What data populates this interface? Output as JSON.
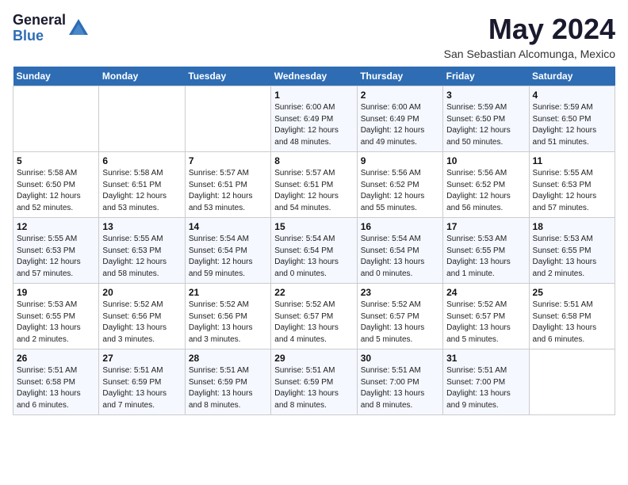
{
  "header": {
    "logo_general": "General",
    "logo_blue": "Blue",
    "month_title": "May 2024",
    "location": "San Sebastian Alcomunga, Mexico"
  },
  "weekdays": [
    "Sunday",
    "Monday",
    "Tuesday",
    "Wednesday",
    "Thursday",
    "Friday",
    "Saturday"
  ],
  "weeks": [
    [
      null,
      null,
      null,
      {
        "day": "1",
        "sunrise": "6:00 AM",
        "sunset": "6:49 PM",
        "daylight": "12 hours and 48 minutes."
      },
      {
        "day": "2",
        "sunrise": "6:00 AM",
        "sunset": "6:49 PM",
        "daylight": "12 hours and 49 minutes."
      },
      {
        "day": "3",
        "sunrise": "5:59 AM",
        "sunset": "6:50 PM",
        "daylight": "12 hours and 50 minutes."
      },
      {
        "day": "4",
        "sunrise": "5:59 AM",
        "sunset": "6:50 PM",
        "daylight": "12 hours and 51 minutes."
      }
    ],
    [
      {
        "day": "5",
        "sunrise": "5:58 AM",
        "sunset": "6:50 PM",
        "daylight": "12 hours and 52 minutes."
      },
      {
        "day": "6",
        "sunrise": "5:58 AM",
        "sunset": "6:51 PM",
        "daylight": "12 hours and 53 minutes."
      },
      {
        "day": "7",
        "sunrise": "5:57 AM",
        "sunset": "6:51 PM",
        "daylight": "12 hours and 53 minutes."
      },
      {
        "day": "8",
        "sunrise": "5:57 AM",
        "sunset": "6:51 PM",
        "daylight": "12 hours and 54 minutes."
      },
      {
        "day": "9",
        "sunrise": "5:56 AM",
        "sunset": "6:52 PM",
        "daylight": "12 hours and 55 minutes."
      },
      {
        "day": "10",
        "sunrise": "5:56 AM",
        "sunset": "6:52 PM",
        "daylight": "12 hours and 56 minutes."
      },
      {
        "day": "11",
        "sunrise": "5:55 AM",
        "sunset": "6:53 PM",
        "daylight": "12 hours and 57 minutes."
      }
    ],
    [
      {
        "day": "12",
        "sunrise": "5:55 AM",
        "sunset": "6:53 PM",
        "daylight": "12 hours and 57 minutes."
      },
      {
        "day": "13",
        "sunrise": "5:55 AM",
        "sunset": "6:53 PM",
        "daylight": "12 hours and 58 minutes."
      },
      {
        "day": "14",
        "sunrise": "5:54 AM",
        "sunset": "6:54 PM",
        "daylight": "12 hours and 59 minutes."
      },
      {
        "day": "15",
        "sunrise": "5:54 AM",
        "sunset": "6:54 PM",
        "daylight": "13 hours and 0 minutes."
      },
      {
        "day": "16",
        "sunrise": "5:54 AM",
        "sunset": "6:54 PM",
        "daylight": "13 hours and 0 minutes."
      },
      {
        "day": "17",
        "sunrise": "5:53 AM",
        "sunset": "6:55 PM",
        "daylight": "13 hours and 1 minute."
      },
      {
        "day": "18",
        "sunrise": "5:53 AM",
        "sunset": "6:55 PM",
        "daylight": "13 hours and 2 minutes."
      }
    ],
    [
      {
        "day": "19",
        "sunrise": "5:53 AM",
        "sunset": "6:55 PM",
        "daylight": "13 hours and 2 minutes."
      },
      {
        "day": "20",
        "sunrise": "5:52 AM",
        "sunset": "6:56 PM",
        "daylight": "13 hours and 3 minutes."
      },
      {
        "day": "21",
        "sunrise": "5:52 AM",
        "sunset": "6:56 PM",
        "daylight": "13 hours and 3 minutes."
      },
      {
        "day": "22",
        "sunrise": "5:52 AM",
        "sunset": "6:57 PM",
        "daylight": "13 hours and 4 minutes."
      },
      {
        "day": "23",
        "sunrise": "5:52 AM",
        "sunset": "6:57 PM",
        "daylight": "13 hours and 5 minutes."
      },
      {
        "day": "24",
        "sunrise": "5:52 AM",
        "sunset": "6:57 PM",
        "daylight": "13 hours and 5 minutes."
      },
      {
        "day": "25",
        "sunrise": "5:51 AM",
        "sunset": "6:58 PM",
        "daylight": "13 hours and 6 minutes."
      }
    ],
    [
      {
        "day": "26",
        "sunrise": "5:51 AM",
        "sunset": "6:58 PM",
        "daylight": "13 hours and 6 minutes."
      },
      {
        "day": "27",
        "sunrise": "5:51 AM",
        "sunset": "6:59 PM",
        "daylight": "13 hours and 7 minutes."
      },
      {
        "day": "28",
        "sunrise": "5:51 AM",
        "sunset": "6:59 PM",
        "daylight": "13 hours and 8 minutes."
      },
      {
        "day": "29",
        "sunrise": "5:51 AM",
        "sunset": "6:59 PM",
        "daylight": "13 hours and 8 minutes."
      },
      {
        "day": "30",
        "sunrise": "5:51 AM",
        "sunset": "7:00 PM",
        "daylight": "13 hours and 8 minutes."
      },
      {
        "day": "31",
        "sunrise": "5:51 AM",
        "sunset": "7:00 PM",
        "daylight": "13 hours and 9 minutes."
      },
      null
    ]
  ]
}
